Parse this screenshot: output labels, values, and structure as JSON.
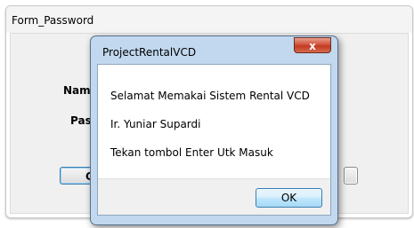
{
  "background_window": {
    "title": "Form_Password",
    "labels": {
      "nama": "Nama",
      "password": "Pass"
    },
    "buttons": {
      "ok": "Ok"
    }
  },
  "dialog": {
    "title": "ProjectRentalVCD",
    "close_glyph": "x",
    "messages": [
      "Selamat Memakai Sistem Rental VCD",
      "Ir. Yuniar Supardi",
      "Tekan tombol Enter Utk Masuk"
    ],
    "ok_label": "OK"
  },
  "colors": {
    "dialog_frame": "#c1d8ee",
    "close_button": "#c23a21",
    "ok_button_border": "#3c7fb1"
  }
}
